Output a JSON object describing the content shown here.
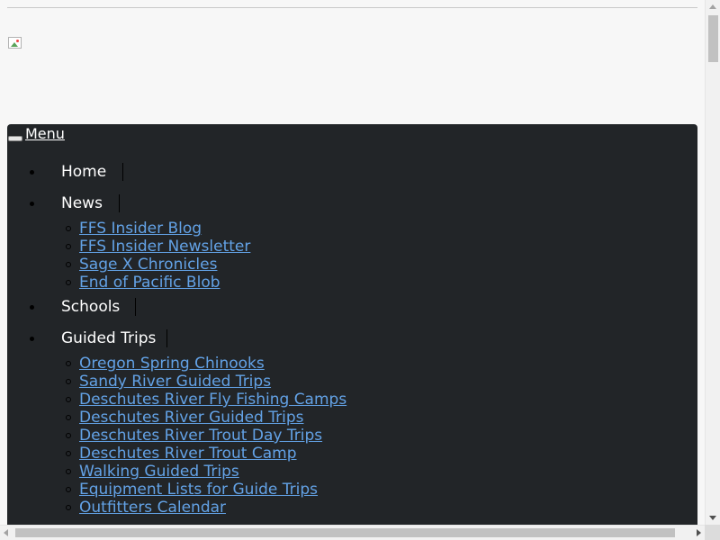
{
  "header": {
    "logo_alt": "",
    "logo_icon": "broken-image-icon"
  },
  "nav": {
    "toggle_label": "Menu",
    "items": [
      {
        "label": "Home",
        "children": []
      },
      {
        "label": "News",
        "children": [
          "FFS Insider Blog",
          "FFS Insider Newsletter",
          "Sage X Chronicles",
          "End of Pacific Blob"
        ]
      },
      {
        "label": "Schools",
        "children": []
      },
      {
        "label": "Guided Trips",
        "children": [
          "Oregon Spring Chinooks",
          "Sandy River Guided Trips",
          "Deschutes River Fly Fishing Camps",
          "Deschutes River Guided Trips",
          "Deschutes River Trout Day Trips",
          "Deschutes River Trout Camp",
          "Walking Guided Trips",
          "Equipment Lists for Guide Trips",
          "Outfitters Calendar"
        ]
      }
    ]
  },
  "colors": {
    "page_bg": "#f7f7f7",
    "nav_bg": "#222528",
    "nav_text": "#ffffff",
    "link": "#63a2e6"
  }
}
